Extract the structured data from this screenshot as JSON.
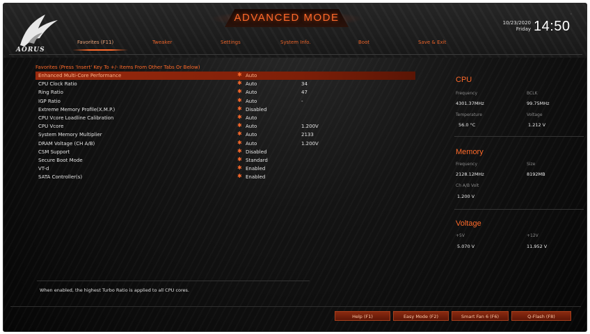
{
  "header": {
    "title": "ADVANCED MODE",
    "logo_text": "AORUS",
    "date": "10/23/2020",
    "day": "Friday",
    "time": "14:50"
  },
  "tabs": [
    {
      "label": "Favorites (F11)",
      "active": true
    },
    {
      "label": "Tweaker",
      "active": false
    },
    {
      "label": "Settings",
      "active": false
    },
    {
      "label": "System Info.",
      "active": false
    },
    {
      "label": "Boot",
      "active": false
    },
    {
      "label": "Save & Exit",
      "active": false
    }
  ],
  "favorites": {
    "header": "Favorites (Press 'Insert' Key To +/- Items From Other Tabs Or Below)",
    "items": [
      {
        "label": "Enhanced Multi-Core Performance",
        "value": "Auto",
        "current": "",
        "selected": true
      },
      {
        "label": "CPU Clock Ratio",
        "value": "Auto",
        "current": "34",
        "selected": false
      },
      {
        "label": "Ring Ratio",
        "value": "Auto",
        "current": "47",
        "selected": false
      },
      {
        "label": "IGP Ratio",
        "value": "Auto",
        "current": "-",
        "selected": false
      },
      {
        "label": "Extreme Memory Profile(X.M.P.)",
        "value": "Disabled",
        "current": "",
        "selected": false
      },
      {
        "label": "CPU Vcore Loadline Calibration",
        "value": "Auto",
        "current": "",
        "selected": false
      },
      {
        "label": "CPU Vcore",
        "value": "Auto",
        "current": "1.200V",
        "selected": false
      },
      {
        "label": "System Memory Multiplier",
        "value": "Auto",
        "current": "2133",
        "selected": false
      },
      {
        "label": "DRAM Voltage    (CH A/B)",
        "value": "Auto",
        "current": "1.200V",
        "selected": false
      },
      {
        "label": "CSM Support",
        "value": "Disabled",
        "current": "",
        "selected": false
      },
      {
        "label": "Secure Boot Mode",
        "value": "Standard",
        "current": "",
        "selected": false
      },
      {
        "label": "VT-d",
        "value": "Enabled",
        "current": "",
        "selected": false
      },
      {
        "label": "SATA Controller(s)",
        "value": "Enabled",
        "current": "",
        "selected": false
      }
    ]
  },
  "help_text": "When enabled, the highest Turbo Ratio is applied to all CPU cores.",
  "info": {
    "cpu": {
      "title": "CPU",
      "frequency_label": "Frequency",
      "frequency": "4301.37MHz",
      "bclk_label": "BCLK",
      "bclk": "99.75MHz",
      "temperature_label": "Temperature",
      "temperature": "56.0 °C",
      "voltage_label": "Voltage",
      "voltage": "1.212 V"
    },
    "memory": {
      "title": "Memory",
      "frequency_label": "Frequency",
      "frequency": "2128.12MHz",
      "size_label": "Size",
      "size": "8192MB",
      "volt_label": "Ch A/B Volt",
      "volt": "1.200 V"
    },
    "voltage": {
      "title": "Voltage",
      "v5_label": "+5V",
      "v5": "5.070 V",
      "v12_label": "+12V",
      "v12": "11.952 V"
    }
  },
  "footer": {
    "buttons": [
      {
        "label": "Help (F1)"
      },
      {
        "label": "Easy Mode (F2)"
      },
      {
        "label": "Smart Fan 6 (F6)"
      },
      {
        "label": "Q-Flash (F8)"
      }
    ]
  },
  "colors": {
    "accent": "#ff6a2a",
    "selected_row": "#8a250c",
    "background": "#0b0b0b"
  }
}
